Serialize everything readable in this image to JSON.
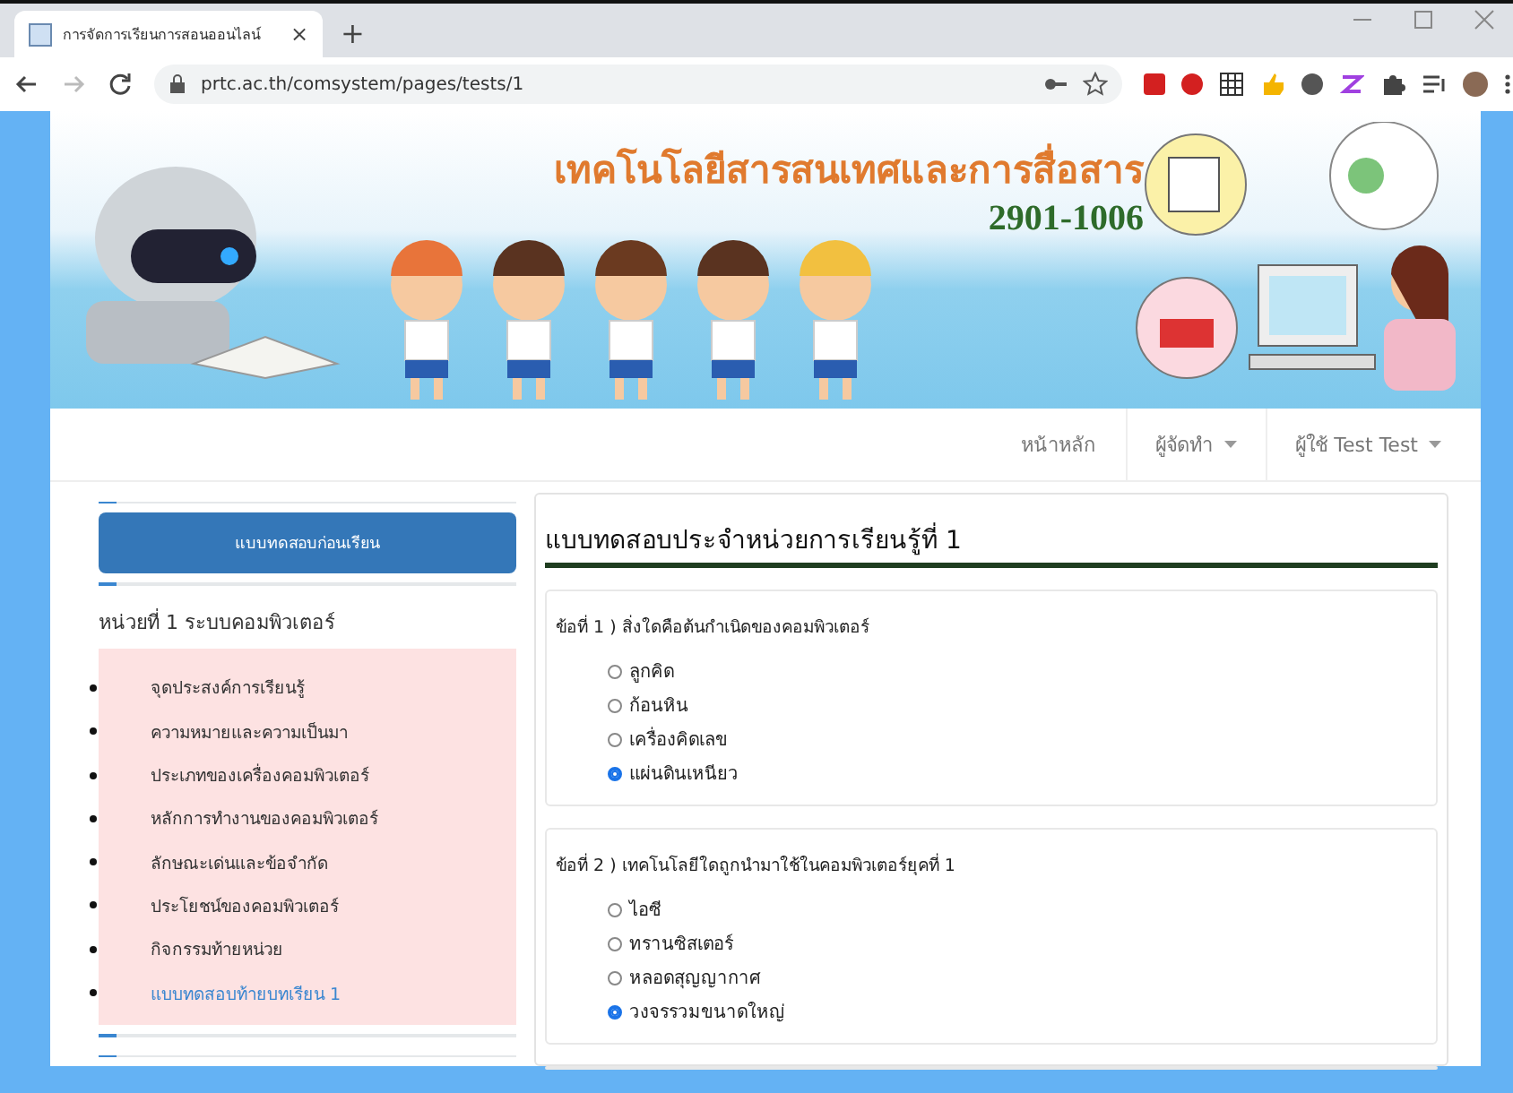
{
  "browser": {
    "tab_title": "การจัดการเรียนการสอนออนไลน์",
    "tab_close": "×",
    "new_tab": "+",
    "url": "prtc.ac.th/comsystem/pages/tests/1"
  },
  "banner": {
    "title": "เทคโนโลยีสารสนเทศและการสื่อสาร",
    "code": "2901-1006"
  },
  "nav": [
    {
      "label": "หน้าหลัก",
      "dropdown": false
    },
    {
      "label": "ผู้จัดทำ",
      "dropdown": true
    },
    {
      "label": "ผู้ใช้ Test Test",
      "dropdown": true
    }
  ],
  "sidebar": {
    "button": "แบบทดสอบก่อนเรียน",
    "unit_title": "หน่วยที่ 1 ระบบคอมพิวเตอร์",
    "items": [
      {
        "label": "จุดประสงค์การเรียนรู้",
        "selected": false
      },
      {
        "label": "ความหมายและความเป็นมา",
        "selected": false
      },
      {
        "label": "ประเภทของเครื่องคอมพิวเตอร์",
        "selected": false
      },
      {
        "label": "หลักการทำงานของคอมพิวเตอร์",
        "selected": false
      },
      {
        "label": "ลักษณะเด่นและข้อจำกัด",
        "selected": false
      },
      {
        "label": "ประโยชน์ของคอมพิวเตอร์",
        "selected": false
      },
      {
        "label": "กิจกรรมท้ายหน่วย",
        "selected": false
      },
      {
        "label": "แบบทดสอบท้ายบทเรียน 1",
        "selected": true
      }
    ]
  },
  "main": {
    "title": "แบบทดสอบประจำหน่วยการเรียนรู้ที่ 1",
    "questions": [
      {
        "text": "ข้อที่ 1 ) สิ่งใดคือต้นกำเนิดของคอมพิวเตอร์",
        "options": [
          {
            "label": "ลูกคิด",
            "selected": false
          },
          {
            "label": "ก้อนหิน",
            "selected": false
          },
          {
            "label": "เครื่องคิดเลข",
            "selected": false
          },
          {
            "label": "แผ่นดินเหนียว",
            "selected": true
          }
        ]
      },
      {
        "text": "ข้อที่ 2 ) เทคโนโลยีใดถูกนำมาใช้ในคอมพิวเตอร์ยุคที่ 1",
        "options": [
          {
            "label": "ไอซี",
            "selected": false
          },
          {
            "label": "ทรานซิสเตอร์",
            "selected": false
          },
          {
            "label": "หลอดสุญญากาศ",
            "selected": false
          },
          {
            "label": "วงจรรวมขนาดใหญ่",
            "selected": true
          }
        ]
      }
    ]
  }
}
